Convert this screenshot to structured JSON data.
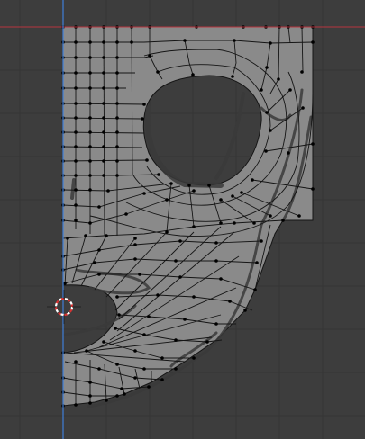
{
  "viewport": {
    "kind": "3d-viewport-edit-mode",
    "view": "orthographic",
    "background_color": "#3d3d3d",
    "grid_color": "#353535",
    "x_axis_color": "#b8353f",
    "y_axis_color": "#3f7fd9",
    "mesh_face_color": "#8a8a8a",
    "mesh_edge_color": "#151515",
    "vertex_color": "#000000",
    "shadow_color": "#2a2a2a"
  },
  "tools": {
    "cursor_3d": "3d-cursor-icon"
  },
  "mesh": {
    "object": "plate-with-hole",
    "features": [
      "circular-hole",
      "semicircular-notch",
      "quad-grid-topology"
    ]
  }
}
